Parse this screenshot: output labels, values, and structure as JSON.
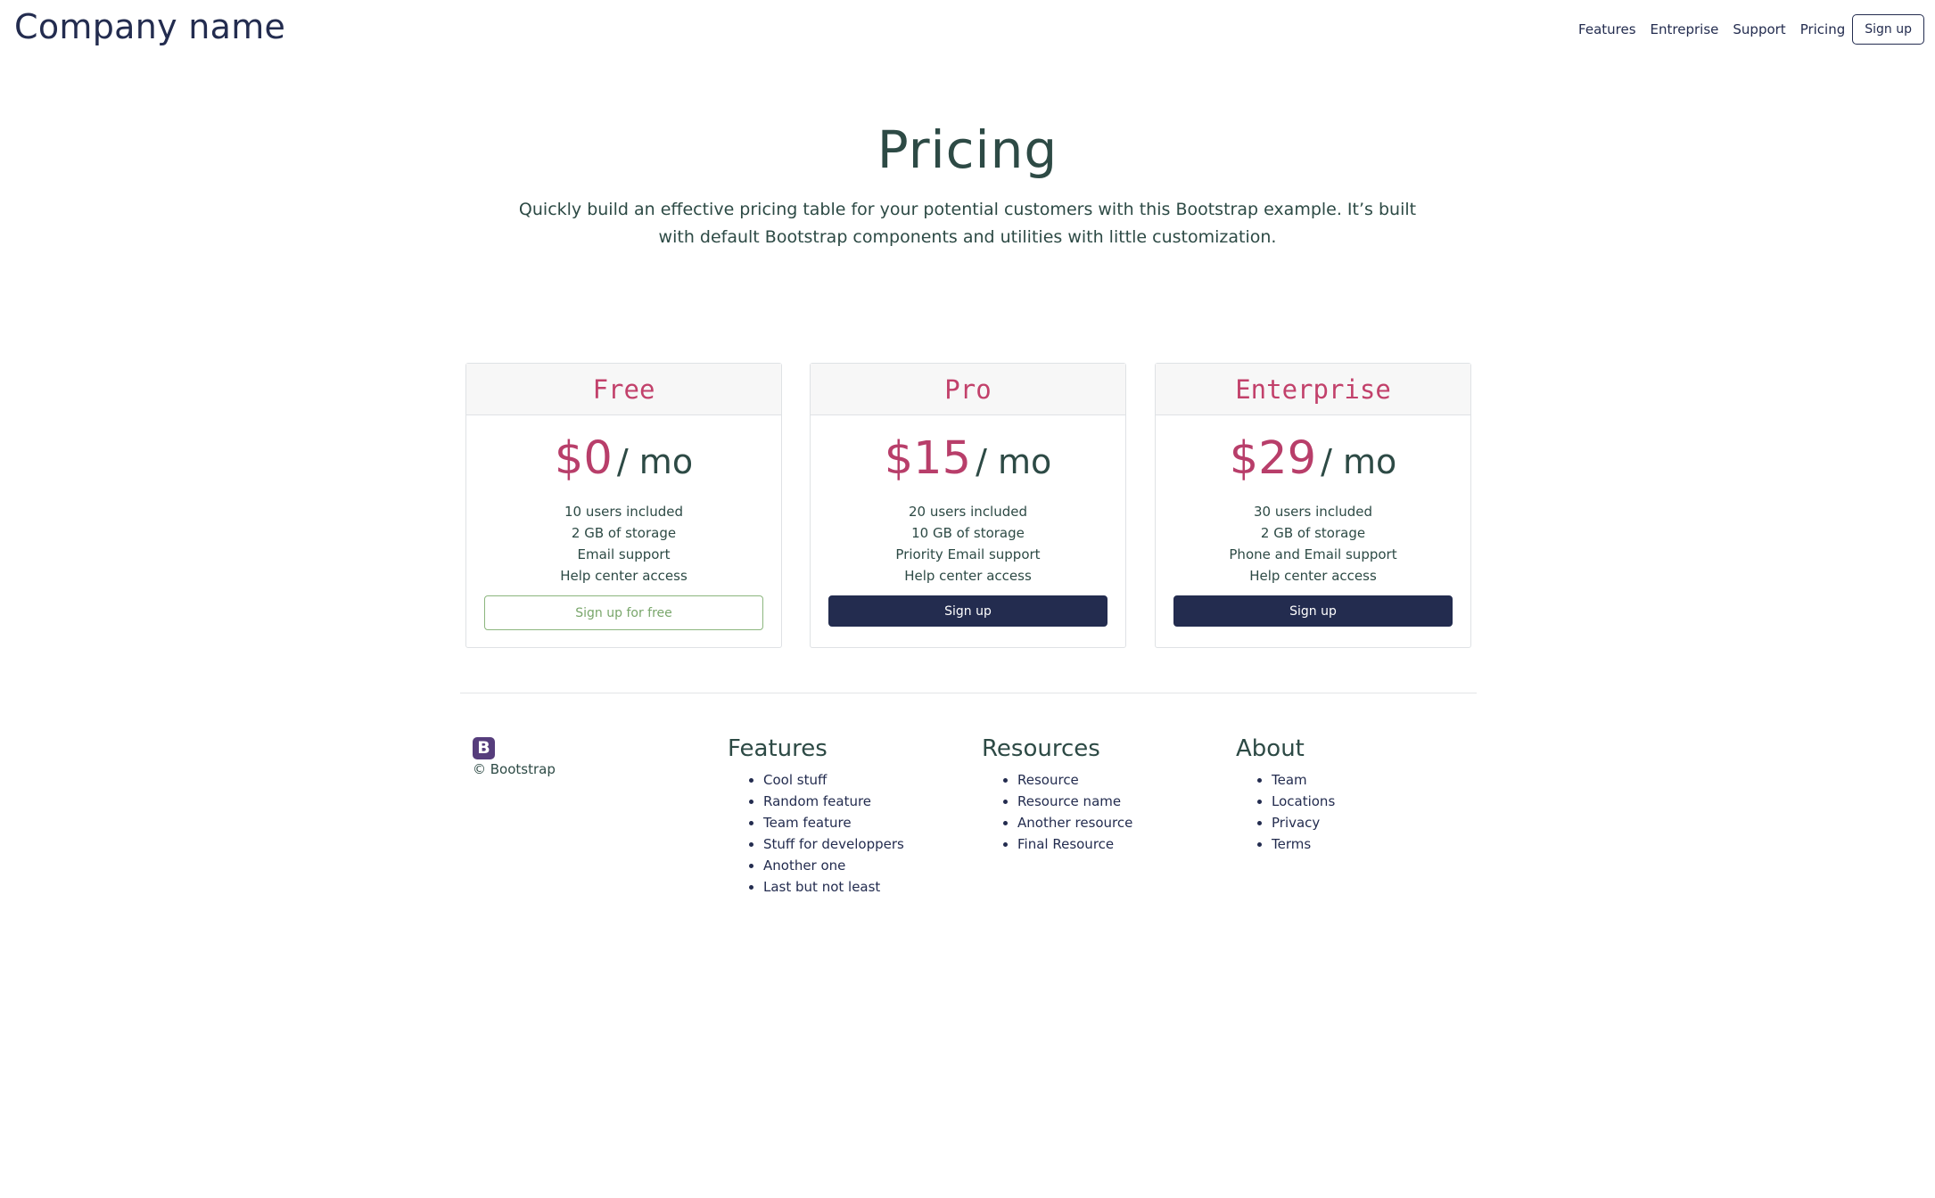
{
  "header": {
    "brand": "Company name",
    "nav": [
      "Features",
      "Entreprise",
      "Support",
      "Pricing"
    ],
    "signup_label": "Sign up"
  },
  "hero": {
    "title": "Pricing",
    "lead": "Quickly build an effective pricing table for your potential customers with this Bootstrap example. It’s built with default Bootstrap components and utilities with little customization."
  },
  "plans": [
    {
      "name": "Free",
      "price": "$0",
      "period": "/ mo",
      "features": [
        "10 users included",
        "2 GB of storage",
        "Email support",
        "Help center access"
      ],
      "button": "Sign up for free"
    },
    {
      "name": "Pro",
      "price": "$15",
      "period": "/ mo",
      "features": [
        "20 users included",
        "10 GB of storage",
        "Priority Email support",
        "Help center access"
      ],
      "button": "Sign up"
    },
    {
      "name": "Enterprise",
      "price": "$29",
      "period": "/ mo",
      "features": [
        "30 users included",
        "2 GB of storage",
        "Phone and Email support",
        "Help center access"
      ],
      "button": "Sign up"
    }
  ],
  "footer": {
    "logo_letter": "B",
    "copyright": "© Bootstrap",
    "columns": [
      {
        "heading": "Features",
        "items": [
          "Cool stuff",
          "Random feature",
          "Team feature",
          "Stuff for developpers",
          "Another one",
          "Last but not least"
        ]
      },
      {
        "heading": "Resources",
        "items": [
          "Resource",
          "Resource name",
          "Another resource",
          "Final Resource"
        ]
      },
      {
        "heading": "About",
        "items": [
          "Team",
          "Locations",
          "Privacy",
          "Terms"
        ]
      }
    ]
  },
  "colors": {
    "brand_navy": "#232c4f",
    "accent_pink": "#b83e6a",
    "text_teal": "#2d4a45",
    "outline_green": "#8cb67e",
    "bootstrap_purple": "#563d7c"
  }
}
